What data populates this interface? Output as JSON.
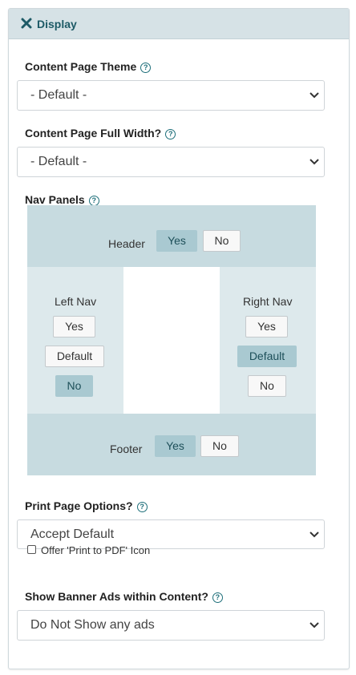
{
  "header": {
    "title": "Display"
  },
  "theme": {
    "label": "Content Page Theme",
    "value": "- Default -"
  },
  "full_width": {
    "label": "Content Page Full Width?",
    "value": "- Default -"
  },
  "nav_panels": {
    "label": "Nav Panels",
    "header": {
      "label": "Header",
      "yes": "Yes",
      "no": "No",
      "selected": "Yes"
    },
    "left": {
      "label": "Left Nav",
      "yes": "Yes",
      "default": "Default",
      "no": "No",
      "selected": "No"
    },
    "right": {
      "label": "Right Nav",
      "yes": "Yes",
      "default": "Default",
      "no": "No",
      "selected": "Default"
    },
    "footer": {
      "label": "Footer",
      "yes": "Yes",
      "no": "No",
      "selected": "Yes"
    }
  },
  "print": {
    "label": "Print Page Options?",
    "value": "Accept Default",
    "checkbox_label": "Offer 'Print to PDF' Icon",
    "checked": false
  },
  "banner": {
    "label": "Show Banner Ads within Content?",
    "value": "Do Not Show any ads"
  },
  "colors": {
    "accent": "#1d5a66",
    "header_bg": "#d6e2e6",
    "active_btn": "#a9c9d1"
  }
}
